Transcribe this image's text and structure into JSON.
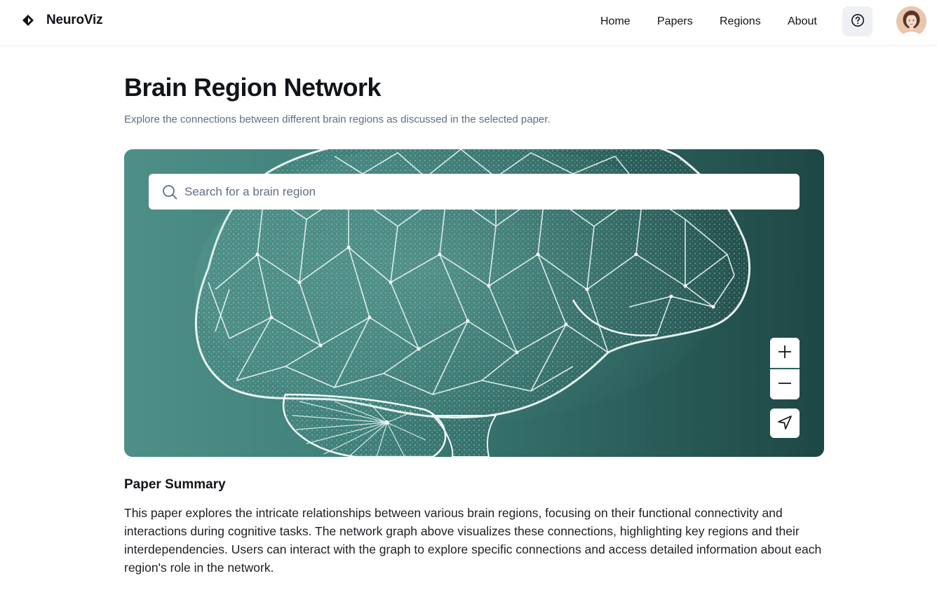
{
  "header": {
    "brand": "NeuroViz",
    "nav": [
      {
        "label": "Home"
      },
      {
        "label": "Papers"
      },
      {
        "label": "Regions"
      },
      {
        "label": "About"
      }
    ],
    "help_icon": "question-circle-icon",
    "avatar_icon": "user-avatar"
  },
  "main": {
    "title": "Brain Region Network",
    "subtitle": "Explore the connections between different brain regions as discussed in the selected paper.",
    "search": {
      "placeholder": "Search for a brain region",
      "value": ""
    },
    "controls": {
      "zoom_in_icon": "plus-icon",
      "zoom_out_icon": "minus-icon",
      "locate_icon": "navigation-arrow-icon"
    },
    "summary": {
      "title": "Paper Summary",
      "text": "This paper explores the intricate relationships between various brain regions, focusing on their functional connectivity and interactions during cognitive tasks. The network graph above visualizes these connections, highlighting key regions and their interdependencies. Users can interact with the graph to explore specific connections and access detailed information about each region's role in the network."
    }
  },
  "colors": {
    "accent": "#111418",
    "subtitle": "#5f6f84",
    "viz_bg_start": "#4e8f88",
    "viz_bg_end": "#1e4745"
  }
}
